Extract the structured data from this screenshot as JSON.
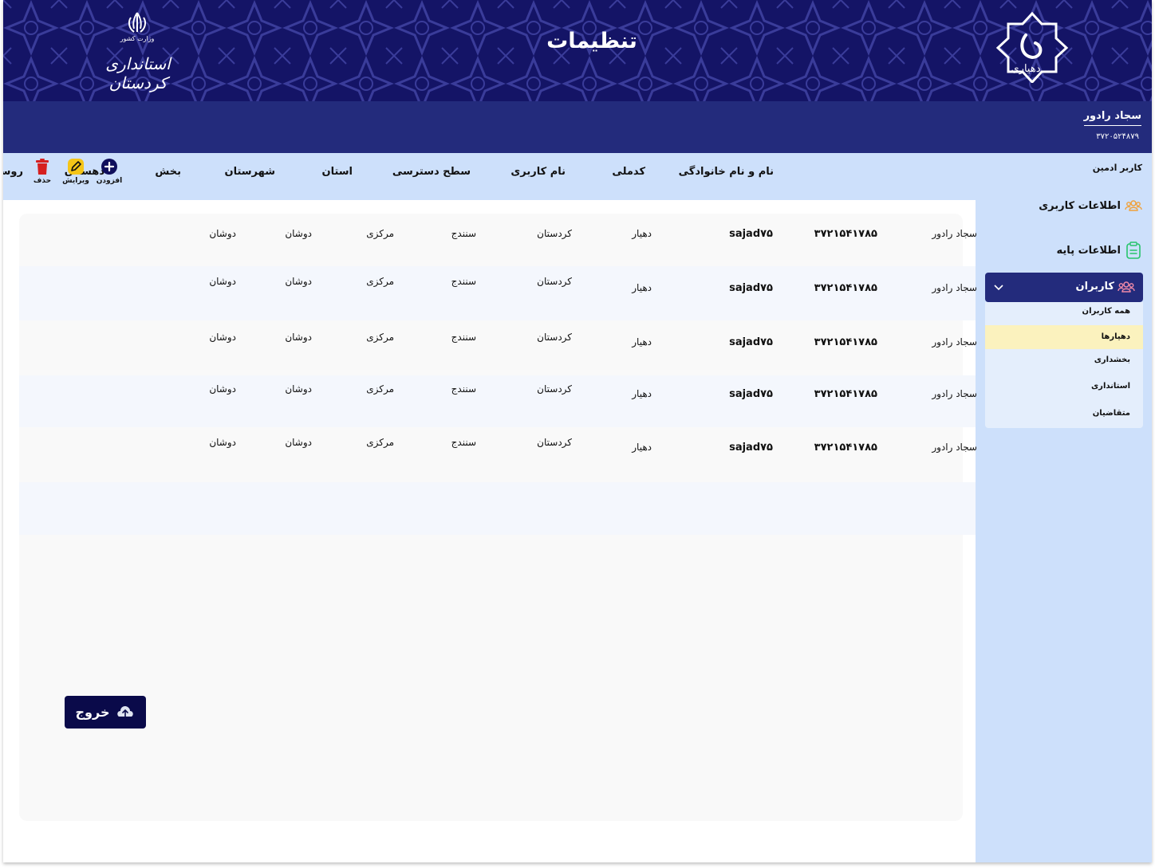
{
  "header": {
    "title": "تنظیمات",
    "left_logo": {
      "emblem": "iran-emblem-icon",
      "ministry": "وزارت کشور",
      "province": "استانداری کردستان"
    },
    "right_logo": {
      "text": "دهیاری"
    }
  },
  "user": {
    "name": "سجاد رادور",
    "code": "۳۷۲۰۵۲۴۸۷۹"
  },
  "sidebar": {
    "role": "کاربر ادمین",
    "items": [
      {
        "label": "اطلاعات کاربری",
        "icon": "users-icon",
        "color": "#f0a13a"
      },
      {
        "label": "اطلاعات پایه",
        "icon": "clipboard-icon",
        "color": "#27c46b"
      }
    ],
    "users_menu": {
      "label": "کاربران",
      "icon": "users-icon",
      "sub_items": [
        "همه کاربران",
        "دهیارها",
        "بخشداری",
        "استانداری",
        "متقاضیان"
      ],
      "active": "دهیارها"
    }
  },
  "table": {
    "columns": [
      "نام و نام خانوادگی",
      "کدملی",
      "نام کاربری",
      "سطح دسترسی",
      "استان",
      "شهرستان",
      "بخش",
      "دهستان",
      "روستا"
    ],
    "rows": [
      [
        "سجاد رادور",
        "۳۷۲۱۵۴۱۷۸۵",
        "sajad۷۵",
        "دهیار",
        "کردستان",
        "سنندج",
        "مرکزی",
        "دوشان",
        "دوشان"
      ],
      [
        "سجاد رادور",
        "۳۷۲۱۵۴۱۷۸۵",
        "sajad۷۵",
        "دهیار",
        "کردستان",
        "سنندج",
        "مرکزی",
        "دوشان",
        "دوشان"
      ],
      [
        "سجاد رادور",
        "۳۷۲۱۵۴۱۷۸۵",
        "sajad۷۵",
        "دهیار",
        "کردستان",
        "سنندج",
        "مرکزی",
        "دوشان",
        "دوشان"
      ],
      [
        "سجاد رادور",
        "۳۷۲۱۵۴۱۷۸۵",
        "sajad۷۵",
        "دهیار",
        "کردستان",
        "سنندج",
        "مرکزی",
        "دوشان",
        "دوشان"
      ],
      [
        "سجاد رادور",
        "۳۷۲۱۵۴۱۷۸۵",
        "sajad۷۵",
        "دهیار",
        "کردستان",
        "سنندج",
        "مرکزی",
        "دوشان",
        "دوشان"
      ]
    ]
  },
  "actions": {
    "add": "افزودن",
    "edit": "ویرایش",
    "delete": "حذف"
  },
  "logout": {
    "label": "خروج",
    "icon": "upload-icon"
  },
  "colors": {
    "header_bg": "#0f0f5c",
    "userbar_bg": "#232b7c",
    "sidebar_bg": "#cde0fb",
    "active_sub": "#fbf2be",
    "delete": "#d62020",
    "edit": "#f5c518"
  }
}
